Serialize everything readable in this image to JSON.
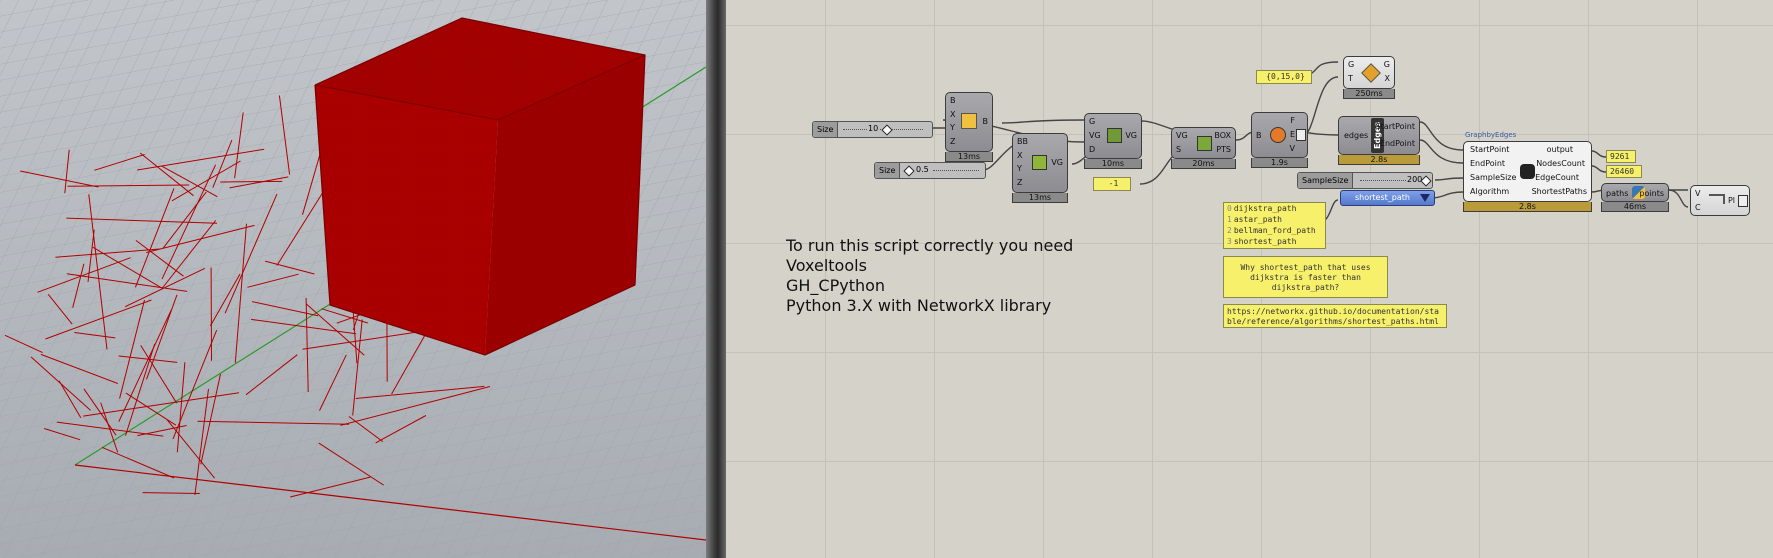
{
  "viewport": {
    "colors": {
      "wire": "#a40000",
      "grid": "#9aa0a6",
      "axis_x": "#c00000",
      "axis_y": "#2a9a2a"
    }
  },
  "note": {
    "lines": [
      "To run this script correctly you need",
      "Voxeltools",
      "GH_CPython",
      "Python 3.X with NetworkX library"
    ]
  },
  "sliders": [
    {
      "label": "Size",
      "value": "10"
    },
    {
      "label": "Size",
      "value": "0.5"
    },
    {
      "label": "SampleSize",
      "value": "200"
    }
  ],
  "components": {
    "box": {
      "inputs": [
        "B",
        "X",
        "Y",
        "Z"
      ],
      "outputs": [
        "B"
      ],
      "time": "13ms"
    },
    "voxgrid": {
      "inputs": [
        "BB",
        "X",
        "Y",
        "Z"
      ],
      "outputs": [
        "VG"
      ],
      "time": "13ms"
    },
    "voxel_op": {
      "inputs": [
        "G",
        "VG",
        "D"
      ],
      "outputs": [
        "VG"
      ],
      "time": "10ms"
    },
    "vox_to_box": {
      "inputs": [
        "VG",
        "S"
      ],
      "outputs": [
        "BOX",
        "PTS"
      ],
      "time": "20ms"
    },
    "fillet": {
      "inputs": [
        "B"
      ],
      "outputs": [
        "F",
        "E",
        "V"
      ],
      "time": "1.9s"
    },
    "edges": {
      "inputs": [
        "edges"
      ],
      "label": "Edges",
      "outputs": [
        "StartPoint",
        "EndPoint"
      ],
      "time": "2.8s"
    },
    "transform": {
      "inputs": [
        "G",
        "T"
      ],
      "outputs": [
        "G",
        "X"
      ],
      "time": "250ms"
    },
    "python": {
      "title": "GraphbyEdges",
      "inputs": [
        "StartPoint",
        "EndPoint",
        "SampleSize",
        "Algorithm"
      ],
      "outputs": [
        "output",
        "NodesCount",
        "EdgeCount",
        "ShortestPaths"
      ],
      "time": "2.8s"
    },
    "paths": {
      "inputs": [
        "paths"
      ],
      "outputs": [
        "points"
      ],
      "time": "46ms"
    },
    "polyline": {
      "inputs": [
        "V",
        "C"
      ],
      "outputs": [
        "Pl"
      ]
    }
  },
  "panels": {
    "vector": "{0,15,0}",
    "minus_one": "-1",
    "algorithms": [
      "dijkstra_path",
      "astar_path",
      "bellman_ford_path",
      "shortest_path"
    ],
    "question": "Why shortest_path that uses dijkstra is faster than dijkstra_path?",
    "url": "https://networkx.github.io/documentation/stable/reference/algorithms/shortest_paths.html",
    "nodes_count": "9261",
    "edge_count": "26460"
  },
  "value_list": {
    "selected": "shortest_path"
  }
}
